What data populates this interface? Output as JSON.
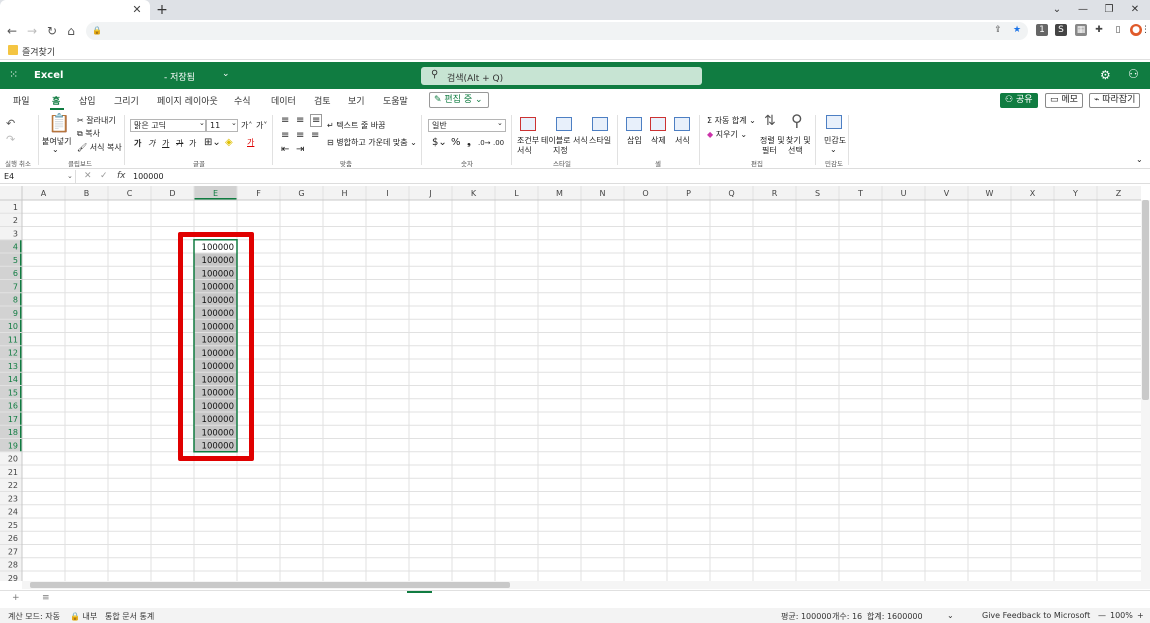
{
  "browser": {
    "bookmarks_label": "즐겨찾기",
    "window_controls": [
      "⌄",
      "—",
      "❐",
      "✕"
    ]
  },
  "excel": {
    "app_name": "Excel",
    "doc_status": "- 저장됨",
    "search_placeholder": "검색(Alt + Q)",
    "menu_tabs": [
      "파일",
      "홈",
      "삽입",
      "그리기",
      "페이지 레이아웃",
      "수식",
      "데이터",
      "검토",
      "보기",
      "도움말"
    ],
    "active_tab": "홈",
    "edit_mode": "편집 중",
    "share_label": "공유",
    "comment_label": "메모",
    "catchup_label": "따라잡기"
  },
  "ribbon": {
    "undo_group": "실행 취소",
    "paste_label": "붙여넣기",
    "cut_label": "잘라내기",
    "copy_label": "복사",
    "format_painter_label": "서식 복사",
    "clipboard_group": "클립보드",
    "font_name": "맑은 고딕",
    "font_size": "11",
    "font_group": "글꼴",
    "wrap_text_label": "텍스트 줄 바꿈",
    "merge_label": "병합하고 가운데 맞춤",
    "alignment_group": "맞춤",
    "number_format": "일반",
    "number_group": "숫자",
    "conditional_label_1": "조건부",
    "conditional_label_2": "서식",
    "table_format_label_1": "테이블로 서식",
    "table_format_label_2": "지정",
    "styles_label": "스타일",
    "styles_group": "스타일",
    "insert_label": "삽입",
    "delete_label": "삭제",
    "format_label": "서식",
    "cells_group": "셀",
    "autosum_label": "자동 합계",
    "clear_label": "지우기",
    "sort_filter_label_1": "정렬 및",
    "sort_filter_label_2": "필터",
    "find_select_label_1": "찾기 및",
    "find_select_label_2": "선택",
    "editing_group": "편집",
    "sensitivity_label": "민감도",
    "sensitivity_group": "민감도"
  },
  "formula_bar": {
    "name_box": "E4",
    "cancel_glyph": "✕",
    "enter_glyph": "✓",
    "fx_label": "fx",
    "value": "100000"
  },
  "sheet": {
    "columns": [
      "A",
      "B",
      "C",
      "D",
      "E",
      "F",
      "G",
      "H",
      "I",
      "J",
      "K",
      "L",
      "M",
      "N",
      "O",
      "P",
      "Q",
      "R",
      "S",
      "T",
      "U",
      "V",
      "W",
      "X",
      "Y",
      "Z"
    ],
    "row_count": 29,
    "selected_column": "E",
    "cells": {
      "E4": "100000",
      "E5": "100000",
      "E6": "100000",
      "E7": "100000",
      "E8": "100000",
      "E9": "100000",
      "E10": "100000",
      "E11": "100000",
      "E12": "100000",
      "E13": "100000",
      "E14": "100000",
      "E15": "100000",
      "E16": "100000",
      "E17": "100000",
      "E18": "100000",
      "E19": "100000"
    },
    "selection_range": "E4:E19"
  },
  "status_bar": {
    "calc_mode": "계산 모드: 자동",
    "sensitivity": "내부",
    "doc_stats": "통합 문서 통계",
    "average": "평균: 100000",
    "count": "개수: 16",
    "sum": "합계: 1600000",
    "feedback": "Give Feedback to Microsoft",
    "zoom": "100%"
  },
  "colors": {
    "excel_green": "#107c41",
    "selection_fill": "#c6c6c6",
    "highlight_red": "#e00000"
  }
}
